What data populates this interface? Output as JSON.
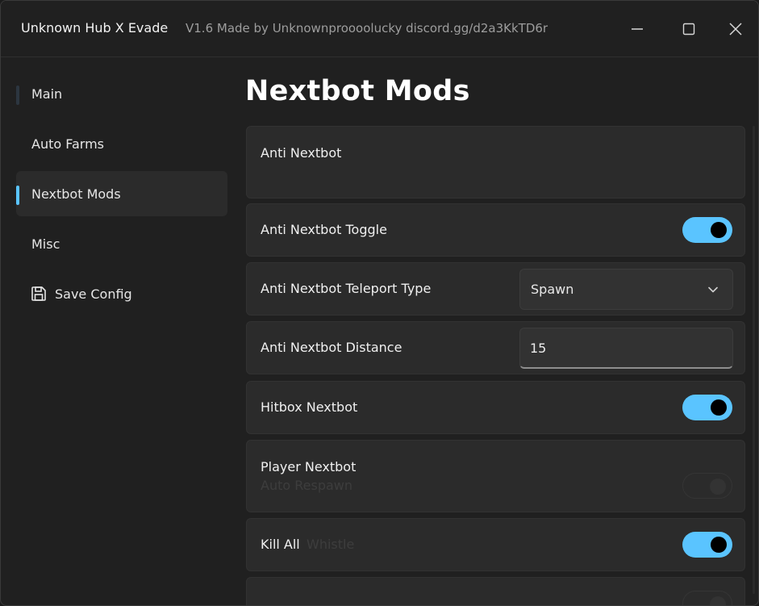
{
  "window": {
    "title": "Unknown Hub X Evade",
    "subtitle": "V1.6 Made by Unknownproooolucky discord.gg/d2a3KkTD6r",
    "accent_color": "#5ac4ff"
  },
  "sidebar": {
    "items": [
      {
        "label": "Main",
        "active": false
      },
      {
        "label": "Auto Farms",
        "active": false
      },
      {
        "label": "Nextbot Mods",
        "active": true
      },
      {
        "label": "Misc",
        "active": false
      },
      {
        "label": "Save Config",
        "icon": "save-icon",
        "active": false
      }
    ]
  },
  "main": {
    "page_title": "Nextbot Mods",
    "section_header": "Anti Nextbot",
    "anti_nextbot_toggle": {
      "label": "Anti Nextbot Toggle",
      "on": true
    },
    "teleport_type": {
      "label": "Anti Nextbot Teleport Type",
      "value": "Spawn"
    },
    "distance": {
      "label": "Anti Nextbot Distance",
      "value": "15"
    },
    "hitbox_nextbot": {
      "label": "Hitbox Nextbot",
      "on": true
    },
    "player_nextbot_header": "Player Nextbot",
    "faded_auto_respawn": "Auto Respawn",
    "kill_all": {
      "label": "Kill All",
      "on": true
    },
    "faded_whistle": "Whistle"
  }
}
